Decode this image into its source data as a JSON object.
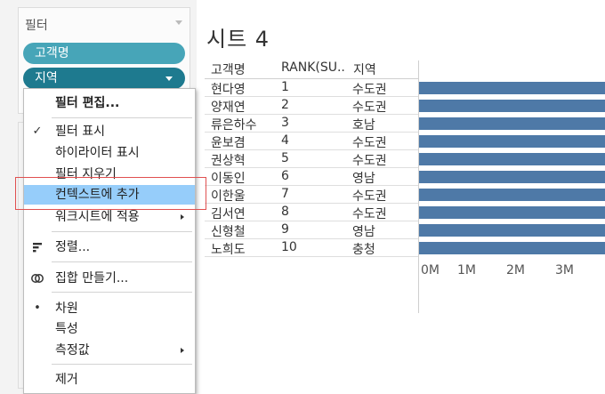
{
  "filters": {
    "title": "필터",
    "pills": [
      {
        "label": "고객명"
      },
      {
        "label": "지역"
      }
    ]
  },
  "context_menu": {
    "items": [
      {
        "label": "필터 편집...",
        "bold": true
      },
      {
        "label": "필터 표시",
        "checked": true
      },
      {
        "label": "하이라이터 표시"
      },
      {
        "label": "필터 지우기"
      },
      {
        "label": "컨텍스트에 추가",
        "highlighted": true
      },
      {
        "label": "워크시트에 적용",
        "submenu": true
      },
      {
        "label": "정렬...",
        "icon": "sort-icon"
      },
      {
        "label": "집합 만들기...",
        "icon": "set-icon"
      },
      {
        "label": "차원",
        "selected_bullet": true
      },
      {
        "label": "특성"
      },
      {
        "label": "측정값",
        "submenu": true
      },
      {
        "label": "제거"
      }
    ]
  },
  "sheet": {
    "title": "시트 4",
    "columns": [
      "고객명",
      "RANK(SU..",
      "지역"
    ],
    "rows": [
      {
        "name": "현다영",
        "rank": "1",
        "region": "수도권"
      },
      {
        "name": "양재연",
        "rank": "2",
        "region": "수도권"
      },
      {
        "name": "류은하수",
        "rank": "3",
        "region": "호남"
      },
      {
        "name": "윤보겸",
        "rank": "4",
        "region": "수도권"
      },
      {
        "name": "권상혁",
        "rank": "5",
        "region": "수도권"
      },
      {
        "name": "이동인",
        "rank": "6",
        "region": "영남"
      },
      {
        "name": "이한울",
        "rank": "7",
        "region": "수도권"
      },
      {
        "name": "김서연",
        "rank": "8",
        "region": "수도권"
      },
      {
        "name": "신형철",
        "rank": "9",
        "region": "영남"
      },
      {
        "name": "노희도",
        "rank": "10",
        "region": "충청"
      }
    ],
    "axis_ticks": [
      "0M",
      "1M",
      "2M",
      "3M"
    ]
  },
  "colors": {
    "bar": "#4e79a7",
    "pill_light": "#47a5b8",
    "pill_dark": "#1e7a8f",
    "menu_highlight": "#96cdfa",
    "callout": "#e05050"
  }
}
